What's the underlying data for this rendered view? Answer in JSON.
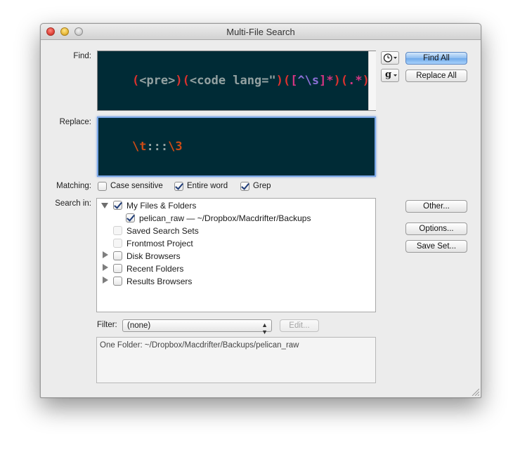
{
  "window": {
    "title": "Multi-File Search"
  },
  "find": {
    "label": "Find:",
    "tokens": [
      {
        "text": "(",
        "color": "#dc322f"
      },
      {
        "text": "<pre>",
        "color": "#93a1a1"
      },
      {
        "text": ")(",
        "color": "#dc322f"
      },
      {
        "text": "<code lang=\"",
        "color": "#93a1a1"
      },
      {
        "text": ")(",
        "color": "#dc322f"
      },
      {
        "text": "[",
        "color": "#d33682"
      },
      {
        "text": "^\\s",
        "color": "#8b6fd6"
      },
      {
        "text": "]*",
        "color": "#d33682"
      },
      {
        "text": ")(",
        "color": "#dc322f"
      },
      {
        "text": ".*",
        "color": "#d33682"
      },
      {
        "text": ")",
        "color": "#dc322f"
      }
    ]
  },
  "replace": {
    "label": "Replace:",
    "tokens": [
      {
        "text": "\\t",
        "color": "#cb4b16"
      },
      {
        "text": ":::",
        "color": "#93a1a1"
      },
      {
        "text": "\\3",
        "color": "#cb4b16"
      }
    ]
  },
  "buttons": {
    "find_all": "Find All",
    "replace_all": "Replace All",
    "other": "Other...",
    "options": "Options...",
    "save_set": "Save Set...",
    "edit": "Edit..."
  },
  "popups": {
    "history_icon": "clock-icon",
    "grep_icon": "g"
  },
  "matching": {
    "label": "Matching:",
    "options": [
      {
        "label": "Case sensitive",
        "checked": false
      },
      {
        "label": "Entire word",
        "checked": true
      },
      {
        "label": "Grep",
        "checked": true
      }
    ]
  },
  "search_in": {
    "label": "Search in:",
    "items": [
      {
        "label": "My Files & Folders",
        "checked": true,
        "disclosure": "expanded"
      },
      {
        "label": "pelican_raw — ~/Dropbox/Macdrifter/Backups",
        "checked": true,
        "disclosure": "none"
      },
      {
        "label": "Saved Search Sets",
        "checked": false,
        "disclosure": "none"
      },
      {
        "label": "Frontmost Project",
        "checked": false,
        "disclosure": "none"
      },
      {
        "label": "Disk Browsers",
        "checked": false,
        "disclosure": "collapsed"
      },
      {
        "label": "Recent Folders",
        "checked": false,
        "disclosure": "collapsed"
      },
      {
        "label": "Results Browsers",
        "checked": false,
        "disclosure": "collapsed"
      }
    ]
  },
  "filter": {
    "label": "Filter:",
    "value": "(none)"
  },
  "info": {
    "text": "One Folder: ~/Dropbox/Macdrifter/Backups/pelican_raw"
  }
}
